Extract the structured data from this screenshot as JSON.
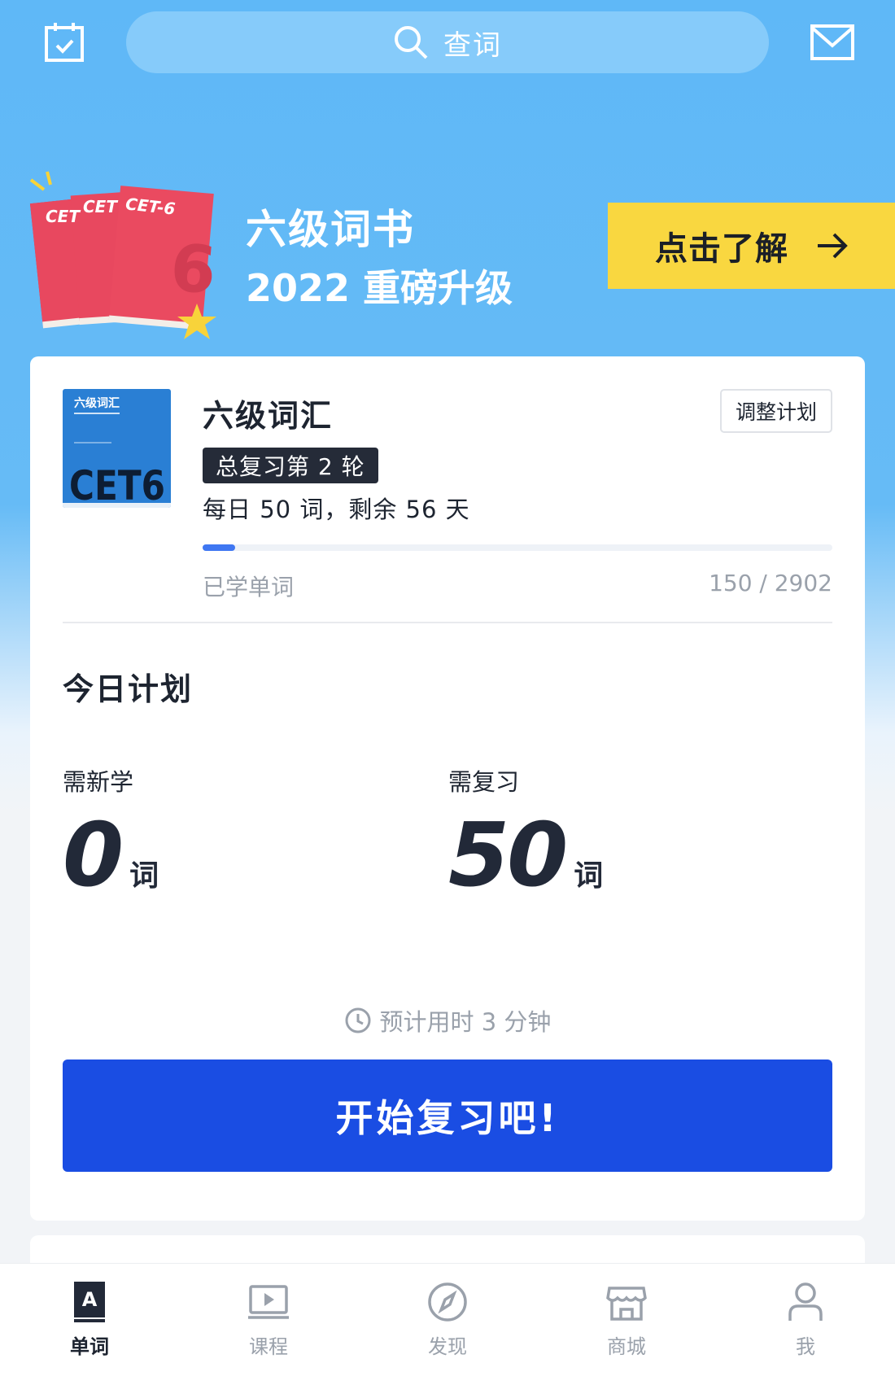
{
  "search": {
    "placeholder": "查词"
  },
  "banner": {
    "title": "六级词书",
    "subtitle": "2022 重磅升级",
    "cta_label": "点击了解",
    "cta_color": "#f9d740",
    "book_labels": [
      "CET",
      "CET",
      "CET-6"
    ]
  },
  "book": {
    "cover_title": "六级词汇",
    "cover_big": "CET6",
    "title": "六级词汇",
    "adjust_label": "调整计划",
    "round_badge": "总复习第 2 轮",
    "daily_text": "每日 50 词，剩余 56 天",
    "learned_label": "已学单词",
    "learned": 150,
    "total": 2902,
    "learned_text": "150 / 2902"
  },
  "plan": {
    "title": "今日计划",
    "new_label": "需新学",
    "new_value": "0",
    "review_label": "需复习",
    "review_value": "50",
    "unit": "词",
    "estimate": "预计用时 3 分钟",
    "start_label": "开始复习吧!"
  },
  "colors": {
    "primary": "#1a4de3",
    "progress": "#3f77f2",
    "sky": "#5fb8f7"
  },
  "nav": {
    "items": [
      {
        "label": "单词",
        "icon": "word-book-icon",
        "active": true
      },
      {
        "label": "课程",
        "icon": "video-course-icon",
        "active": false
      },
      {
        "label": "发现",
        "icon": "compass-icon",
        "active": false
      },
      {
        "label": "商城",
        "icon": "store-icon",
        "active": false
      },
      {
        "label": "我",
        "icon": "person-icon",
        "active": false
      }
    ]
  }
}
